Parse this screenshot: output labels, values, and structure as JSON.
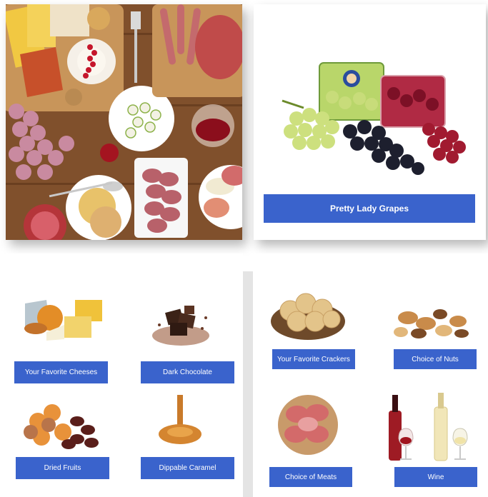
{
  "featured": {
    "label": "Pretty Lady Grapes"
  },
  "tiles_left": [
    {
      "label": "Your Favorite Cheeses"
    },
    {
      "label": "Dark Chocolate"
    },
    {
      "label": "Dried Fruits"
    },
    {
      "label": "Dippable Caramel"
    }
  ],
  "tiles_right": [
    {
      "label": "Your Favorite Crackers"
    },
    {
      "label": "Choice of Nuts"
    },
    {
      "label": "Choice of Meats"
    },
    {
      "label": "Wine"
    }
  ],
  "colors": {
    "button": "#3a63cc",
    "board": "#8a5a32"
  }
}
